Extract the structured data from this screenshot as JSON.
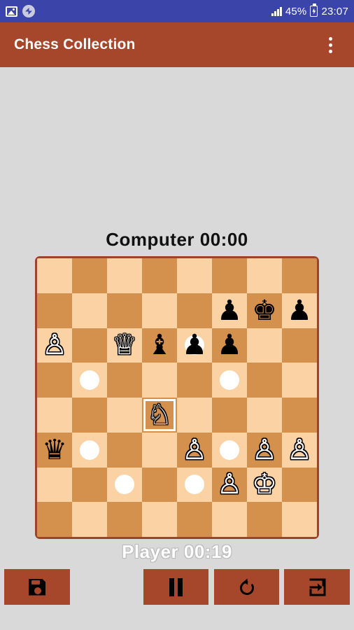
{
  "status_bar": {
    "icons": [
      "photo-icon",
      "sync-icon",
      "signal-icon",
      "battery-charging-icon"
    ],
    "battery_percent": "45%",
    "clock": "23:07"
  },
  "app_bar": {
    "title": "Chess Collection",
    "overflow_menu": "overflow-menu-icon"
  },
  "game": {
    "top_player": {
      "name": "Computer",
      "clock": "00:00",
      "label": "Computer  00:00"
    },
    "bottom_player": {
      "name": "Player",
      "clock": "00:19",
      "label": "Player  00:19"
    }
  },
  "colors": {
    "status_bar": "#3b44a8",
    "app_bar": "#a6462b",
    "page_background": "#d9d9d9",
    "board_border": "#9c4429",
    "light_square": "#fbd2a4",
    "dark_square": "#d4914e",
    "move_dot": "#ffffff",
    "selection_outline": "#ffffff"
  },
  "board": {
    "files": [
      "a",
      "b",
      "c",
      "d",
      "e",
      "f",
      "g",
      "h"
    ],
    "ranks": [
      "8",
      "7",
      "6",
      "5",
      "4",
      "3",
      "2",
      "1"
    ],
    "selected_square": "d4",
    "rows": [
      [
        {
          "square": "a8",
          "shade": "light",
          "piece": null,
          "dot": false,
          "selected": false
        },
        {
          "square": "b8",
          "shade": "dark",
          "piece": null,
          "dot": false,
          "selected": false
        },
        {
          "square": "c8",
          "shade": "light",
          "piece": null,
          "dot": false,
          "selected": false
        },
        {
          "square": "d8",
          "shade": "dark",
          "piece": null,
          "dot": false,
          "selected": false
        },
        {
          "square": "e8",
          "shade": "light",
          "piece": null,
          "dot": false,
          "selected": false
        },
        {
          "square": "f8",
          "shade": "dark",
          "piece": null,
          "dot": false,
          "selected": false
        },
        {
          "square": "g8",
          "shade": "light",
          "piece": null,
          "dot": false,
          "selected": false
        },
        {
          "square": "h8",
          "shade": "dark",
          "piece": null,
          "dot": false,
          "selected": false
        }
      ],
      [
        {
          "square": "a7",
          "shade": "dark",
          "piece": null,
          "dot": false,
          "selected": false
        },
        {
          "square": "b7",
          "shade": "light",
          "piece": null,
          "dot": false,
          "selected": false
        },
        {
          "square": "c7",
          "shade": "dark",
          "piece": null,
          "dot": false,
          "selected": false
        },
        {
          "square": "d7",
          "shade": "light",
          "piece": null,
          "dot": false,
          "selected": false
        },
        {
          "square": "e7",
          "shade": "dark",
          "piece": null,
          "dot": false,
          "selected": false
        },
        {
          "square": "f7",
          "shade": "light",
          "piece": {
            "color": "black",
            "type": "pawn",
            "glyph": "♟"
          },
          "dot": false,
          "selected": false
        },
        {
          "square": "g7",
          "shade": "dark",
          "piece": {
            "color": "black",
            "type": "king",
            "glyph": "♚"
          },
          "dot": false,
          "selected": false
        },
        {
          "square": "h7",
          "shade": "light",
          "piece": {
            "color": "black",
            "type": "pawn",
            "glyph": "♟"
          },
          "dot": false,
          "selected": false
        }
      ],
      [
        {
          "square": "a6",
          "shade": "light",
          "piece": {
            "color": "white",
            "type": "pawn",
            "glyph": "♙"
          },
          "dot": false,
          "selected": false
        },
        {
          "square": "b6",
          "shade": "dark",
          "piece": null,
          "dot": false,
          "selected": false
        },
        {
          "square": "c6",
          "shade": "light",
          "piece": {
            "color": "white",
            "type": "queen",
            "glyph": "♕"
          },
          "dot": false,
          "selected": false
        },
        {
          "square": "d6",
          "shade": "dark",
          "piece": {
            "color": "black",
            "type": "bishop",
            "glyph": "♝"
          },
          "dot": false,
          "selected": false
        },
        {
          "square": "e6",
          "shade": "light",
          "piece": {
            "color": "black",
            "type": "pawn",
            "glyph": "♟"
          },
          "dot": true,
          "selected": false
        },
        {
          "square": "f6",
          "shade": "dark",
          "piece": {
            "color": "black",
            "type": "pawn",
            "glyph": "♟"
          },
          "dot": false,
          "selected": false
        },
        {
          "square": "g6",
          "shade": "light",
          "piece": null,
          "dot": false,
          "selected": false
        },
        {
          "square": "h6",
          "shade": "dark",
          "piece": null,
          "dot": false,
          "selected": false
        }
      ],
      [
        {
          "square": "a5",
          "shade": "dark",
          "piece": null,
          "dot": false,
          "selected": false
        },
        {
          "square": "b5",
          "shade": "light",
          "piece": null,
          "dot": true,
          "selected": false
        },
        {
          "square": "c5",
          "shade": "dark",
          "piece": null,
          "dot": false,
          "selected": false
        },
        {
          "square": "d5",
          "shade": "light",
          "piece": null,
          "dot": false,
          "selected": false
        },
        {
          "square": "e5",
          "shade": "dark",
          "piece": null,
          "dot": false,
          "selected": false
        },
        {
          "square": "f5",
          "shade": "light",
          "piece": null,
          "dot": true,
          "selected": false
        },
        {
          "square": "g5",
          "shade": "dark",
          "piece": null,
          "dot": false,
          "selected": false
        },
        {
          "square": "h5",
          "shade": "light",
          "piece": null,
          "dot": false,
          "selected": false
        }
      ],
      [
        {
          "square": "a4",
          "shade": "light",
          "piece": null,
          "dot": false,
          "selected": false
        },
        {
          "square": "b4",
          "shade": "dark",
          "piece": null,
          "dot": false,
          "selected": false
        },
        {
          "square": "c4",
          "shade": "light",
          "piece": null,
          "dot": false,
          "selected": false
        },
        {
          "square": "d4",
          "shade": "dark",
          "piece": {
            "color": "white",
            "type": "knight",
            "glyph": "♘"
          },
          "dot": false,
          "selected": true
        },
        {
          "square": "e4",
          "shade": "light",
          "piece": null,
          "dot": false,
          "selected": false
        },
        {
          "square": "f4",
          "shade": "dark",
          "piece": null,
          "dot": false,
          "selected": false
        },
        {
          "square": "g4",
          "shade": "light",
          "piece": null,
          "dot": false,
          "selected": false
        },
        {
          "square": "h4",
          "shade": "dark",
          "piece": null,
          "dot": false,
          "selected": false
        }
      ],
      [
        {
          "square": "a3",
          "shade": "dark",
          "piece": {
            "color": "black",
            "type": "queen",
            "glyph": "♛"
          },
          "dot": false,
          "selected": false
        },
        {
          "square": "b3",
          "shade": "light",
          "piece": null,
          "dot": true,
          "selected": false
        },
        {
          "square": "c3",
          "shade": "dark",
          "piece": null,
          "dot": false,
          "selected": false
        },
        {
          "square": "d3",
          "shade": "light",
          "piece": null,
          "dot": false,
          "selected": false
        },
        {
          "square": "e3",
          "shade": "dark",
          "piece": {
            "color": "white",
            "type": "pawn",
            "glyph": "♙"
          },
          "dot": false,
          "selected": false
        },
        {
          "square": "f3",
          "shade": "light",
          "piece": null,
          "dot": true,
          "selected": false
        },
        {
          "square": "g3",
          "shade": "dark",
          "piece": {
            "color": "white",
            "type": "pawn",
            "glyph": "♙"
          },
          "dot": false,
          "selected": false
        },
        {
          "square": "h3",
          "shade": "light",
          "piece": {
            "color": "white",
            "type": "pawn",
            "glyph": "♙"
          },
          "dot": false,
          "selected": false
        }
      ],
      [
        {
          "square": "a2",
          "shade": "light",
          "piece": null,
          "dot": false,
          "selected": false
        },
        {
          "square": "b2",
          "shade": "dark",
          "piece": null,
          "dot": false,
          "selected": false
        },
        {
          "square": "c2",
          "shade": "light",
          "piece": null,
          "dot": true,
          "selected": false
        },
        {
          "square": "d2",
          "shade": "dark",
          "piece": null,
          "dot": false,
          "selected": false
        },
        {
          "square": "e2",
          "shade": "light",
          "piece": null,
          "dot": true,
          "selected": false
        },
        {
          "square": "f2",
          "shade": "dark",
          "piece": {
            "color": "white",
            "type": "pawn",
            "glyph": "♙"
          },
          "dot": false,
          "selected": false
        },
        {
          "square": "g2",
          "shade": "light",
          "piece": {
            "color": "white",
            "type": "king",
            "glyph": "♔"
          },
          "dot": false,
          "selected": false
        },
        {
          "square": "h2",
          "shade": "dark",
          "piece": null,
          "dot": false,
          "selected": false
        }
      ],
      [
        {
          "square": "a1",
          "shade": "dark",
          "piece": null,
          "dot": false,
          "selected": false
        },
        {
          "square": "b1",
          "shade": "light",
          "piece": null,
          "dot": false,
          "selected": false
        },
        {
          "square": "c1",
          "shade": "dark",
          "piece": null,
          "dot": false,
          "selected": false
        },
        {
          "square": "d1",
          "shade": "light",
          "piece": null,
          "dot": false,
          "selected": false
        },
        {
          "square": "e1",
          "shade": "dark",
          "piece": null,
          "dot": false,
          "selected": false
        },
        {
          "square": "f1",
          "shade": "light",
          "piece": null,
          "dot": false,
          "selected": false
        },
        {
          "square": "g1",
          "shade": "dark",
          "piece": null,
          "dot": false,
          "selected": false
        },
        {
          "square": "h1",
          "shade": "light",
          "piece": null,
          "dot": false,
          "selected": false
        }
      ]
    ]
  },
  "toolbar": {
    "buttons": [
      {
        "id": "save",
        "icon": "save-icon",
        "label": "Save"
      },
      {
        "id": "pause",
        "icon": "pause-icon",
        "label": "Pause"
      },
      {
        "id": "undo",
        "icon": "undo-icon",
        "label": "Undo"
      },
      {
        "id": "exit",
        "icon": "exit-icon",
        "label": "Exit"
      }
    ]
  }
}
